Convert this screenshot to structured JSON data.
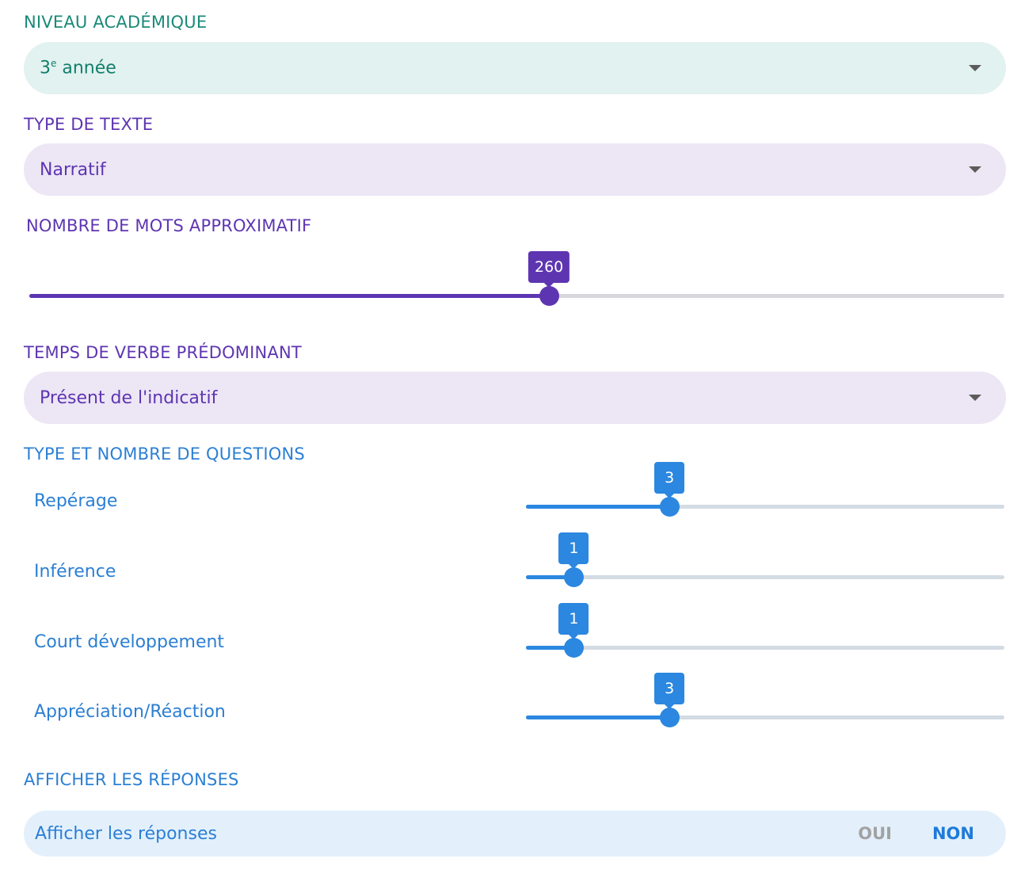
{
  "niveau": {
    "label": "NIVEAU ACADÉMIQUE",
    "value_prefix": "3",
    "value_sup": "e",
    "value_suffix": " année"
  },
  "type_texte": {
    "label": "TYPE DE TEXTE",
    "value": "Narratif"
  },
  "nombre_mots": {
    "label": "NOMBRE DE MOTS APPROXIMATIF",
    "value": "260",
    "fraction": 0.533
  },
  "temps_verbe": {
    "label": "TEMPS DE VERBE PRÉDOMINANT",
    "value": "Présent de l'indicatif"
  },
  "questions": {
    "label": "TYPE ET NOMBRE DE QUESTIONS",
    "items": [
      {
        "label": "Repérage",
        "value": "3",
        "fraction": 0.3
      },
      {
        "label": "Inférence",
        "value": "1",
        "fraction": 0.1
      },
      {
        "label": "Court développement",
        "value": "1",
        "fraction": 0.1
      },
      {
        "label": "Appréciation/Réaction",
        "value": "3",
        "fraction": 0.3
      }
    ]
  },
  "reponses": {
    "label": "AFFICHER LES RÉPONSES",
    "row_label": "Afficher les réponses",
    "option_yes": "OUI",
    "option_no": "NON",
    "selected": "NON"
  },
  "colors": {
    "teal": "#1a8a78",
    "purple": "#5e35b1",
    "blue": "#2b87e0",
    "muted": "#a2a2a2"
  },
  "icons": {
    "dropdown": "caret-down-icon"
  }
}
